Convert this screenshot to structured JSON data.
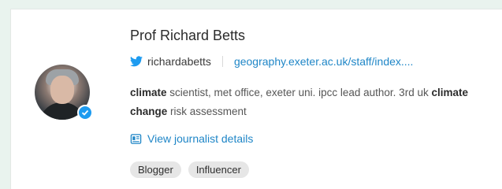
{
  "profile": {
    "name": "Prof Richard Betts",
    "twitter_handle": "richardabetts",
    "website": "geography.exeter.ac.uk/staff/index....",
    "bio": [
      {
        "text": "climate",
        "bold": true
      },
      {
        "text": " scientist, met office, exeter uni. ipcc lead author. 3rd uk ",
        "bold": false
      },
      {
        "text": "climate change",
        "bold": true
      },
      {
        "text": " risk assessment",
        "bold": false
      }
    ],
    "details_link": "View journalist details",
    "tags": [
      "Blogger",
      "Influencer"
    ]
  },
  "icons": {
    "twitter": "twitter-bird-icon",
    "details": "document-icon",
    "verified": "verified-check-icon"
  },
  "colors": {
    "link": "#1f86c7",
    "twitter": "#1d9bf0",
    "tag_bg": "#e6e6e6",
    "page_bg": "#e9f3ee"
  }
}
